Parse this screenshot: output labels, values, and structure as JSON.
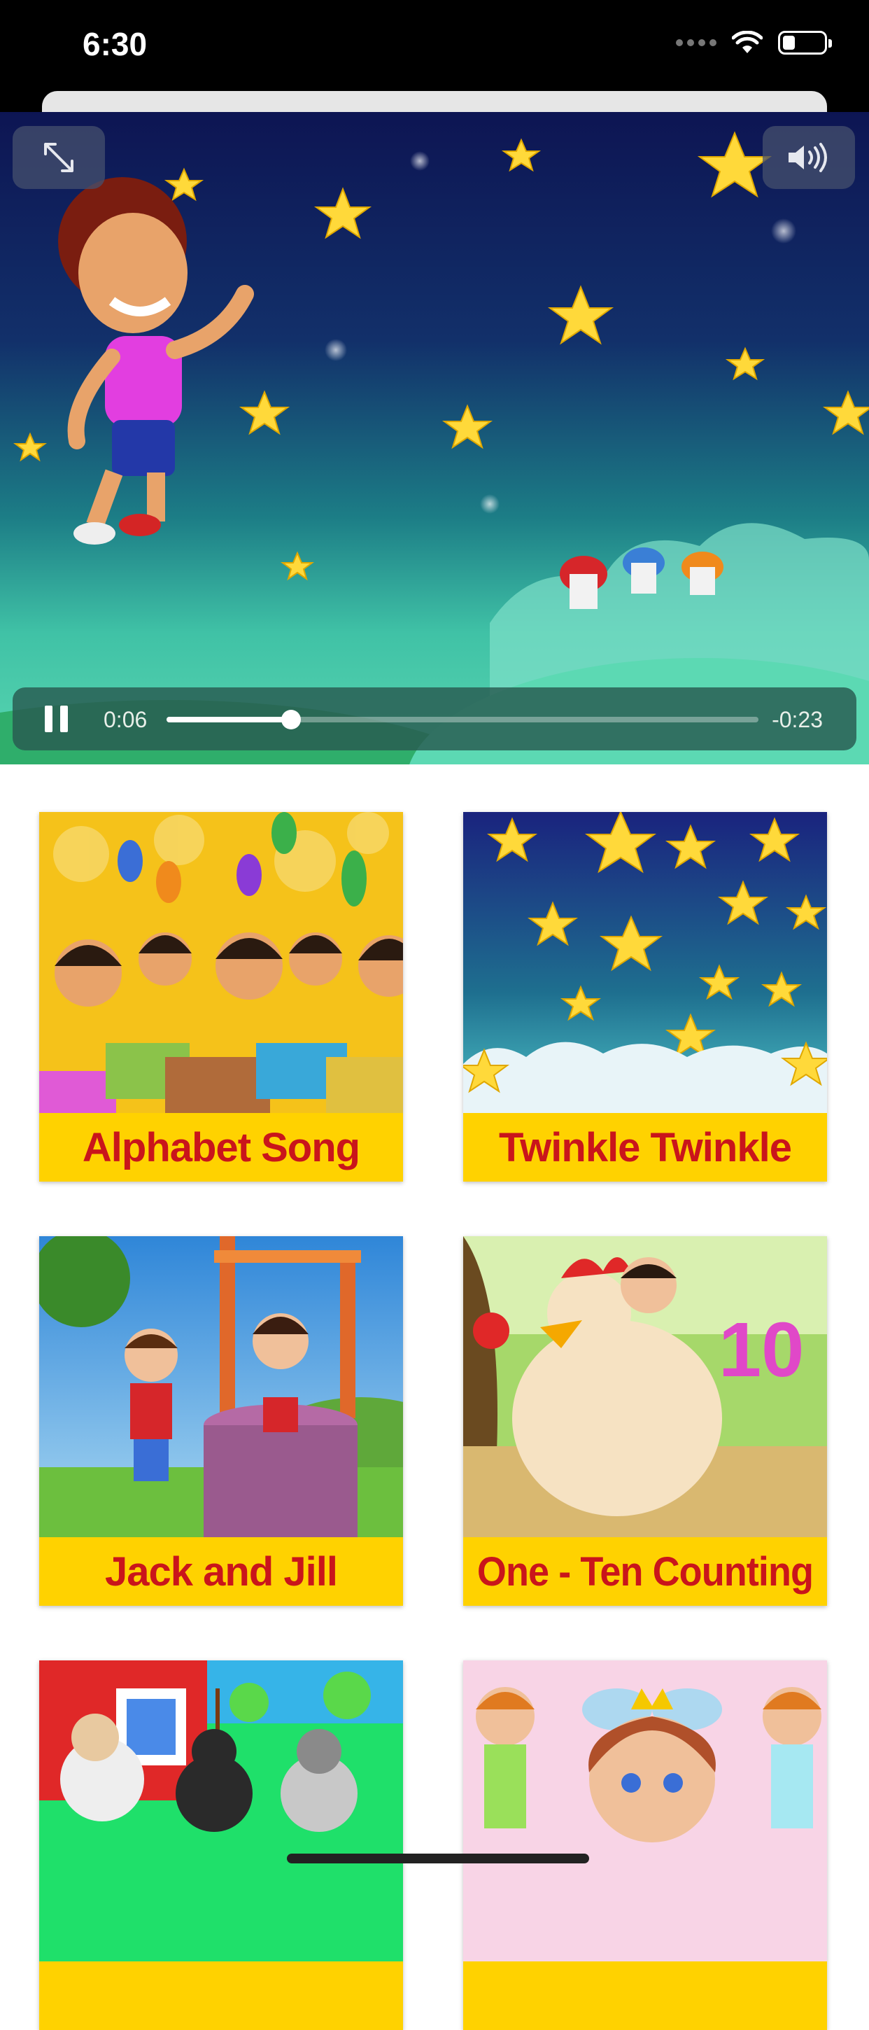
{
  "status_bar": {
    "time": "6:30",
    "battery_level": 0.3
  },
  "video_player": {
    "elapsed": "0:06",
    "remaining": "-0:23",
    "progress": 0.21,
    "state": "playing",
    "fullscreen_icon": "expand-arrows-icon",
    "volume_icon": "speaker-icon"
  },
  "videos": [
    {
      "title": "Alphabet Song"
    },
    {
      "title": "Twinkle Twinkle"
    },
    {
      "title": "Jack and Jill"
    },
    {
      "title": "One - Ten Counting"
    },
    {
      "title": ""
    },
    {
      "title": ""
    }
  ],
  "colors": {
    "label_bg": "#ffd200",
    "label_text": "#c9151b"
  }
}
